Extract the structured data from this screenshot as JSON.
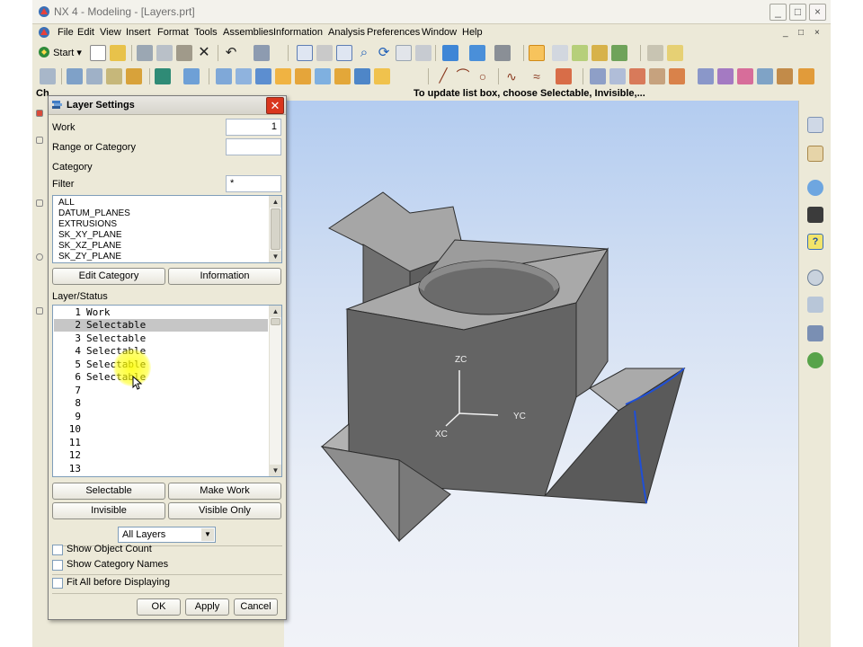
{
  "window": {
    "title": "NX 4 - Modeling - [Layers.prt]",
    "icon": "nx-app-icon",
    "controls": [
      "minimize",
      "maximize",
      "close"
    ]
  },
  "menubar": {
    "items": [
      "File",
      "Edit",
      "View",
      "Insert",
      "Format",
      "Tools",
      "Assemblies",
      "Information",
      "Analysis",
      "Preferences",
      "Window",
      "Help"
    ],
    "right_controls": [
      "_",
      "□",
      "×"
    ]
  },
  "toolbar1": {
    "start_label": "Start",
    "icons": [
      "new-icon",
      "open-icon",
      "cut-icon",
      "copy-icon",
      "paste-icon",
      "delete-icon",
      "undo-icon",
      "select-icon",
      "fit-icon",
      "zoom-icon",
      "rotate-icon",
      "pan-icon",
      "shaded-icon",
      "view-icon",
      "render-icon",
      "snap-icon",
      "grid-icon"
    ]
  },
  "toolbar2": {
    "icons": [
      "sketch-icon",
      "extrude-icon",
      "revolve-icon",
      "hole-icon",
      "boss-icon",
      "pocket-icon",
      "block-icon",
      "cylinder-icon",
      "cone-icon",
      "sphere-icon",
      "line-icon",
      "arc-icon",
      "circle-icon",
      "curve-icon",
      "offset-icon",
      "trim-icon",
      "edge-blend-icon",
      "chamfer-icon",
      "surface-icon"
    ]
  },
  "cue_line": {
    "left_text": "Ch",
    "right_text": "To update list box, choose Selectable, Invisible,..."
  },
  "dialog": {
    "title": "Layer Settings",
    "work_label": "Work",
    "work_value": "1",
    "range_label": "Range or Category",
    "range_value": "",
    "category_label": "Category",
    "filter_label": "Filter",
    "filter_value": "*",
    "categories": [
      "ALL",
      "DATUM_PLANES",
      "EXTRUSIONS",
      "SK_XY_PLANE",
      "SK_XZ_PLANE",
      "SK_ZY_PLANE"
    ],
    "edit_category_label": "Edit Category",
    "information_label": "Information",
    "layer_status_label": "Layer/Status",
    "layers": [
      {
        "num": "1",
        "status": "Work"
      },
      {
        "num": "2",
        "status": "Selectable"
      },
      {
        "num": "3",
        "status": "Selectable"
      },
      {
        "num": "4",
        "status": "Selectable"
      },
      {
        "num": "5",
        "status": "Selectable"
      },
      {
        "num": "6",
        "status": "Selectable"
      },
      {
        "num": "7",
        "status": ""
      },
      {
        "num": "8",
        "status": ""
      },
      {
        "num": "9",
        "status": ""
      },
      {
        "num": "10",
        "status": ""
      },
      {
        "num": "11",
        "status": ""
      },
      {
        "num": "12",
        "status": ""
      },
      {
        "num": "13",
        "status": ""
      }
    ],
    "selected_layer": "2",
    "selectable_label": "Selectable",
    "make_work_label": "Make Work",
    "invisible_label": "Invisible",
    "visible_only_label": "Visible Only",
    "layer_filter_value": "All Layers",
    "show_object_count_label": "Show Object Count",
    "show_category_names_label": "Show Category Names",
    "fit_all_label": "Fit All before Displaying",
    "ok_label": "OK",
    "apply_label": "Apply",
    "cancel_label": "Cancel"
  },
  "graphics": {
    "axis_labels": {
      "z": "ZC",
      "y": "YC",
      "x": "XC"
    }
  },
  "right_bar": {
    "icons": [
      "assembly-navigator-icon",
      "part-navigator-icon",
      "web-browser-icon",
      "training-icon",
      "help-icon",
      "history-icon",
      "reuse-library-icon",
      "process-studio-icon",
      "roles-icon"
    ]
  },
  "colors": {
    "window_bg": "#ece9d8",
    "graphics_top": "#b3ccf0",
    "graphics_bottom": "#f1f3f8",
    "model_face_light": "#a3a3a3",
    "model_face_mid": "#7d7d7d",
    "model_face_dark": "#5c5c5c",
    "edge_highlight": "#1f4fd6",
    "close_button": "#d9361e",
    "selection": "#c6c6c6"
  }
}
